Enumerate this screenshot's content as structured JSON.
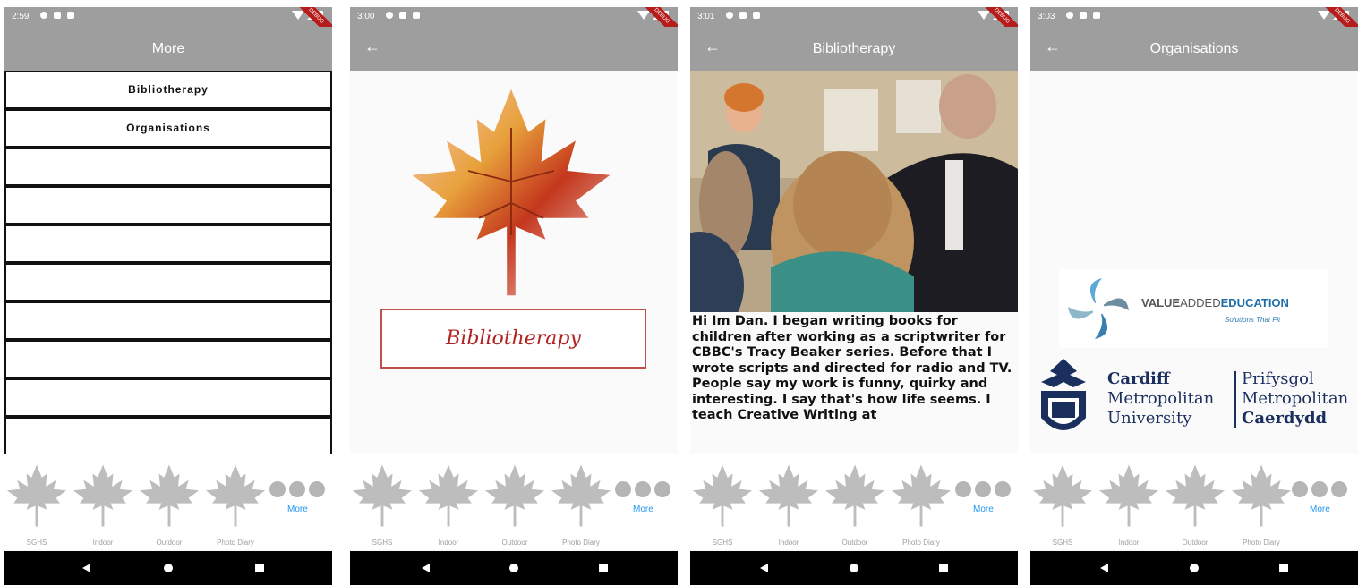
{
  "status_times": [
    "2:59",
    "3:00",
    "3:01",
    "3:03"
  ],
  "debug_badge": "DEBUG",
  "screen1": {
    "title": "More",
    "items": [
      "Bibliotherapy",
      "Organisations",
      "",
      "",
      "",
      "",
      "",
      "",
      "",
      ""
    ]
  },
  "screen2": {
    "banner": "Bibliotherapy"
  },
  "screen3": {
    "title": "Bibliotherapy",
    "bio": "Hi Im Dan. I began writing books for children after working as a scriptwriter for CBBC's Tracy Beaker series. Before that I wrote scripts and directed for radio and TV. People say my work is funny, quirky and interesting. I say that's how life seems. I teach Creative Writing at"
  },
  "screen4": {
    "title": "Organisations",
    "vae": {
      "value": "VALUE",
      "added": "ADDED",
      "education": "EDUCATION",
      "tagline": "Solutions That Fit"
    },
    "cardiff": {
      "l1": "Cardiff",
      "l2": "Metropolitan",
      "l3": "University",
      "r1": "Prifysgol",
      "r2": "Metropolitan",
      "r3": "Caerdydd"
    }
  },
  "nav": {
    "items": [
      "SGHS",
      "Indoor",
      "Outdoor",
      "Photo Diary"
    ],
    "more": "More",
    "icon": "maple-leaf-icon",
    "active_color": "#2196f3",
    "inactive_color": "#bdbdbd"
  },
  "colors": {
    "appbar": "#9e9e9e",
    "banner_border": "#c0504d",
    "banner_text": "#b22222"
  }
}
